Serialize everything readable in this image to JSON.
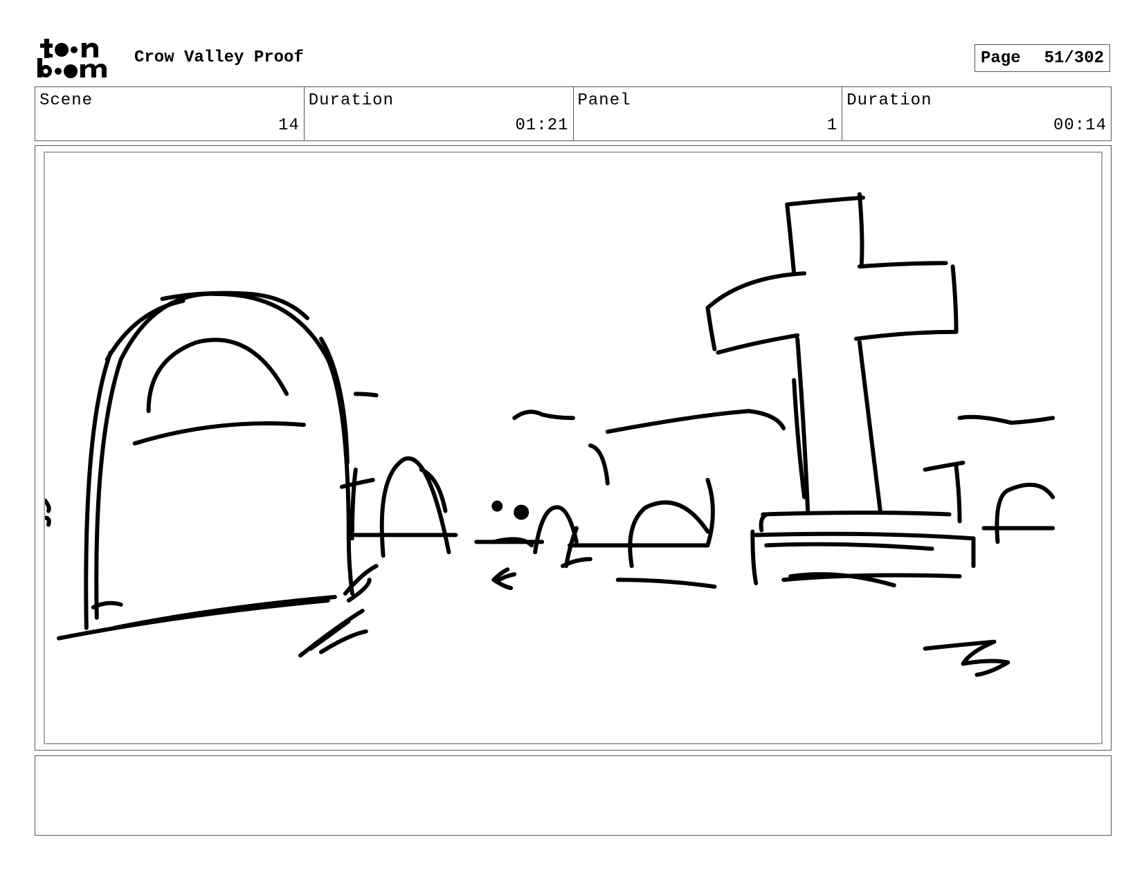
{
  "header": {
    "logo_text": "toon boom",
    "project_title": "Crow Valley Proof",
    "page_label": "Page",
    "page_value": "51/302"
  },
  "info": {
    "scene": {
      "label": "Scene",
      "value": "14"
    },
    "scene_duration": {
      "label": "Duration",
      "value": "01:21"
    },
    "panel": {
      "label": "Panel",
      "value": "1"
    },
    "panel_duration": {
      "label": "Duration",
      "value": "00:14"
    }
  },
  "notes": {
    "text": ""
  },
  "colors": {
    "ink": "#000000",
    "border": "#555555",
    "panel_border": "#aaaaaa"
  }
}
